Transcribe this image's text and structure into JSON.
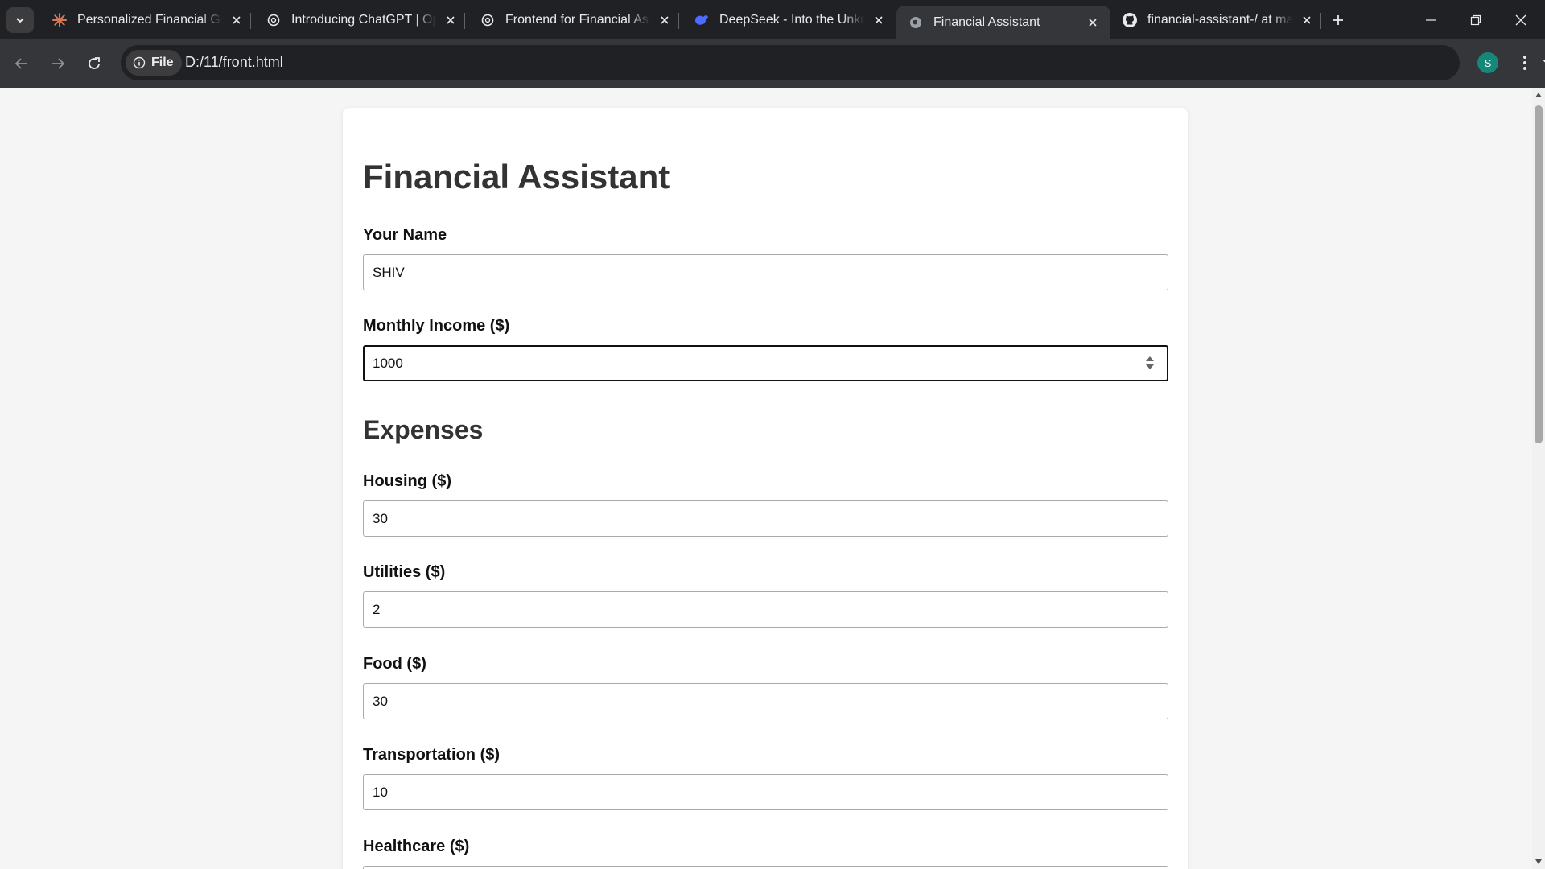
{
  "browser": {
    "tabs": [
      {
        "title": "Personalized Financial Guidance",
        "favicon": "claude-icon",
        "active": false
      },
      {
        "title": "Introducing ChatGPT | OpenAI",
        "favicon": "openai-icon",
        "active": false
      },
      {
        "title": "Frontend for Financial Assistant",
        "favicon": "openai-icon",
        "active": false
      },
      {
        "title": "DeepSeek - Into the Unknown",
        "favicon": "deepseek-icon",
        "active": false
      },
      {
        "title": "Financial Assistant",
        "favicon": "globe-icon",
        "active": true
      },
      {
        "title": "financial-assistant-/ at main",
        "favicon": "github-icon",
        "active": false
      }
    ],
    "address": {
      "scheme_chip": "File",
      "url": "D:/11/front.html"
    },
    "profile_initial": "S",
    "colors": {
      "frame": "#202124",
      "toolbar": "#35363a",
      "profile": "#15887a",
      "accent_claude": "#d97757",
      "accent_deepseek": "#4d6bfe"
    }
  },
  "page": {
    "title": "Financial Assistant",
    "fields_top": [
      {
        "label": "Your Name",
        "value": "SHIV",
        "type": "text"
      },
      {
        "label": "Monthly Income ($)",
        "value": "1000",
        "type": "number",
        "focused": true
      }
    ],
    "expenses_heading": "Expenses",
    "expenses": [
      {
        "label": "Housing ($)",
        "value": "30"
      },
      {
        "label": "Utilities ($)",
        "value": "2"
      },
      {
        "label": "Food ($)",
        "value": "30"
      },
      {
        "label": "Transportation ($)",
        "value": "10"
      },
      {
        "label": "Healthcare ($)",
        "value": ""
      }
    ]
  }
}
